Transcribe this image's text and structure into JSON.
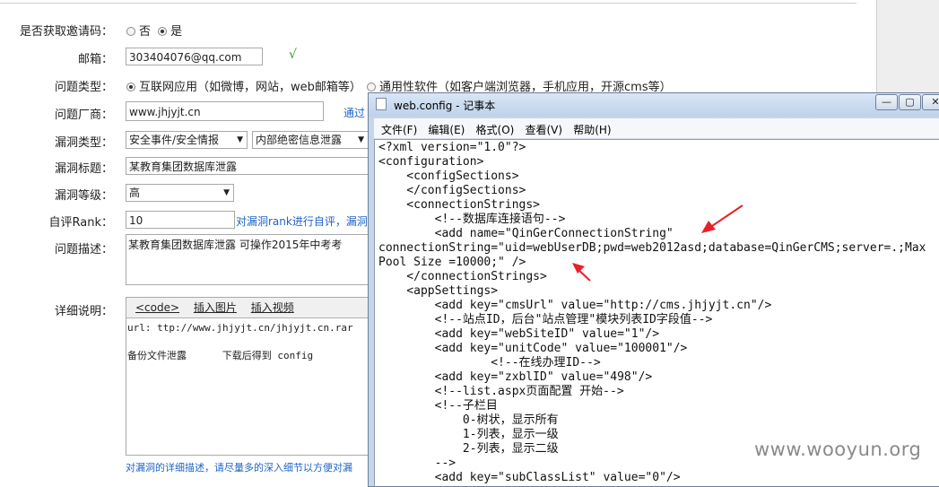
{
  "form": {
    "invite": {
      "label": "是否获取邀请码：",
      "options": [
        "否",
        "是"
      ],
      "selected": "是"
    },
    "email": {
      "label": "邮箱：",
      "value": "303404076@qq.com",
      "check": "√"
    },
    "issue_type": {
      "label": "问题类型：",
      "options": [
        "互联网应用（如微博，网站，web邮箱等）",
        "通用性软件（如客户端浏览器，手机应用，开源cms等）"
      ],
      "selected": "互联网应用（如微博，网站，web邮箱等）"
    },
    "vendor": {
      "label": "问题厂商：",
      "value": "www.jhjyjt.cn",
      "link": "通过"
    },
    "vuln_type": {
      "label": "漏洞类型：",
      "primary": "安全事件/安全情报",
      "secondary": "内部绝密信息泄露"
    },
    "vuln_title": {
      "label": "漏洞标题：",
      "value": "某教育集团数据库泄露"
    },
    "vuln_level": {
      "label": "漏洞等级：",
      "value": "高"
    },
    "rank": {
      "label": "自评Rank：",
      "value": "10",
      "hint": "对漏洞rank进行自评，漏洞"
    },
    "description": {
      "label": "问题描述：",
      "value": "某教育集团数据库泄露 可操作2015年中考考"
    },
    "details": {
      "label": "详细说明：",
      "toolbar": [
        "<code>",
        "插入图片",
        "插入视频"
      ],
      "line1": "url: ttp://www.jhjyjt.cn/jhjyjt.cn.rar",
      "line2": "备份文件泄露      下载后得到 config",
      "hint": "对漏洞的详细描述，请尽量多的深入细节以方便对漏"
    }
  },
  "notepad": {
    "title": "web.config - 记事本",
    "controls": {
      "minimize": "—",
      "maximize": "▢",
      "close": "✕"
    },
    "menu": [
      "文件(F)",
      "编辑(E)",
      "格式(O)",
      "查看(V)",
      "帮助(H)"
    ],
    "lines": [
      "<?xml version=\"1.0\"?>",
      "<configuration>",
      "    <configSections>",
      "    </configSections>",
      "    <connectionStrings>",
      "        <!--数据库连接语句-->",
      "        <add name=\"QinGerConnectionString\"",
      "connectionString=\"uid=webUserDB;pwd=web2012asd;database=QinGerCMS;server=.;Max",
      "Pool Size =10000;\" />",
      "    </connectionStrings>",
      "    <appSettings>",
      "        <add key=\"cmsUrl\" value=\"http://cms.jhjyjt.cn\"/>",
      "        <!--站点ID，后台\"站点管理\"模块列表ID字段值-->",
      "        <add key=\"webSiteID\" value=\"1\"/>",
      "        <add key=\"unitCode\" value=\"100001\"/>",
      "                <!--在线办理ID-->",
      "        <add key=\"zxblID\" value=\"498\"/>",
      "        <!--list.aspx页面配置 开始-->",
      "        <!--子栏目",
      "            0-树状，显示所有",
      "            1-列表，显示一级",
      "            2-列表，显示二级",
      "        -->",
      "        <add key=\"subClassList\" value=\"0\"/>"
    ]
  },
  "annotation_color": "#e8202a",
  "watermark": "www.wooyun.org"
}
